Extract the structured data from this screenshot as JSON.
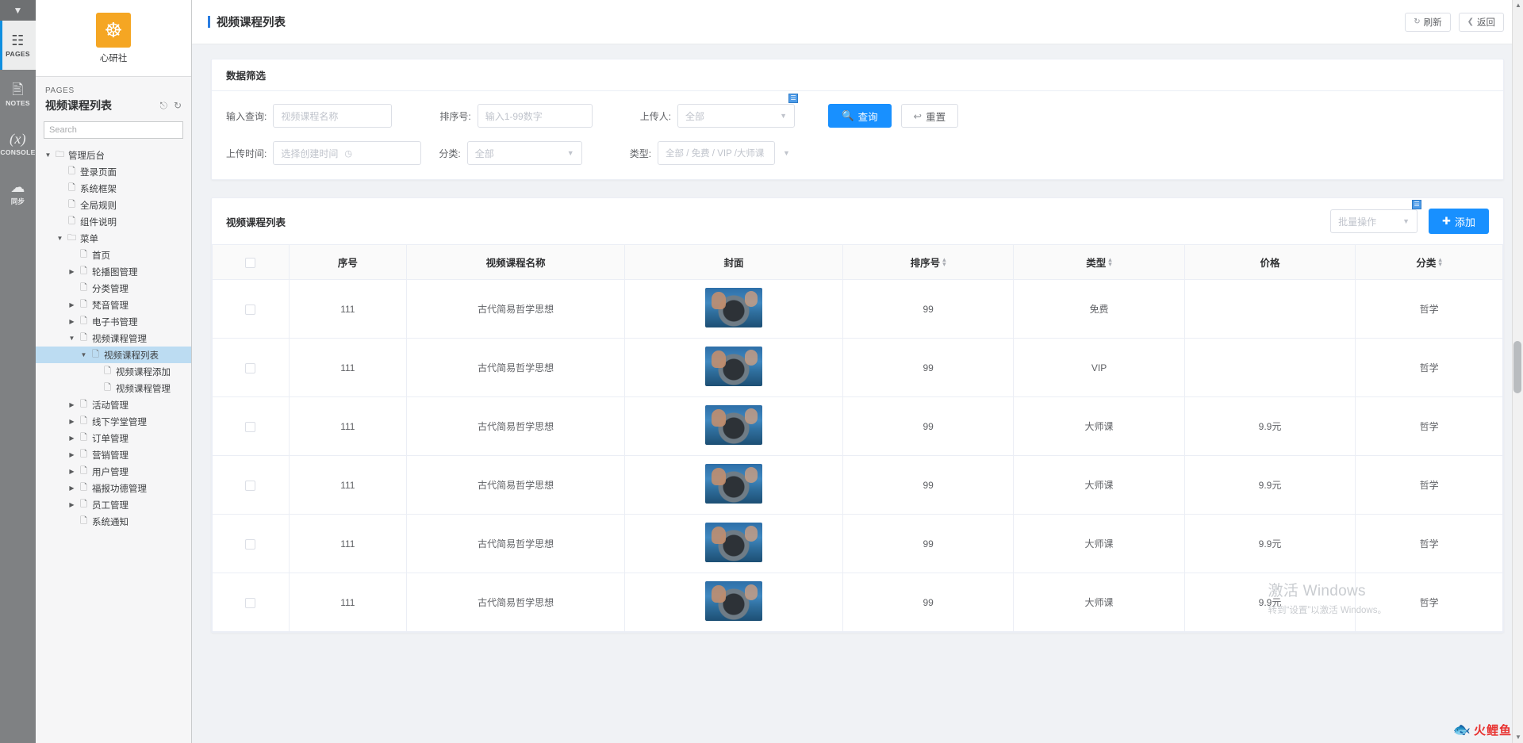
{
  "rail": {
    "collapse_icon": "chevron-down",
    "items": [
      {
        "label": "PAGES",
        "icon": "sitemap-icon",
        "active": true
      },
      {
        "label": "NOTES",
        "icon": "notes-icon",
        "active": false
      },
      {
        "label": "CONSOLE",
        "icon": "variable-icon",
        "active": false
      },
      {
        "label": "同步",
        "icon": "cloud-sync-icon",
        "active": false
      }
    ]
  },
  "brand": {
    "name": "心研社",
    "logo_glyph": "࿕",
    "logo_color": "#f5a623"
  },
  "pages_panel": {
    "kicker": "PAGES",
    "title": "视频课程列表",
    "icon_expand": "expand-icon",
    "icon_refresh": "refresh-icon",
    "search_placeholder": "Search",
    "search_value": ""
  },
  "tree": [
    {
      "label": "管理后台",
      "depth": 0,
      "type": "folder",
      "twisty": "down",
      "selected": false
    },
    {
      "label": "登录页面",
      "depth": 1,
      "type": "page",
      "twisty": "none",
      "selected": false
    },
    {
      "label": "系统框架",
      "depth": 1,
      "type": "page",
      "twisty": "none",
      "selected": false
    },
    {
      "label": "全局规则",
      "depth": 1,
      "type": "page",
      "twisty": "none",
      "selected": false
    },
    {
      "label": "组件说明",
      "depth": 1,
      "type": "page",
      "twisty": "none",
      "selected": false
    },
    {
      "label": "菜单",
      "depth": 1,
      "type": "folder",
      "twisty": "down",
      "selected": false
    },
    {
      "label": "首页",
      "depth": 2,
      "type": "page",
      "twisty": "none",
      "selected": false
    },
    {
      "label": "轮播图管理",
      "depth": 2,
      "type": "page",
      "twisty": "right",
      "selected": false
    },
    {
      "label": "分类管理",
      "depth": 2,
      "type": "page",
      "twisty": "none",
      "selected": false
    },
    {
      "label": "梵音管理",
      "depth": 2,
      "type": "page",
      "twisty": "right",
      "selected": false
    },
    {
      "label": "电子书管理",
      "depth": 2,
      "type": "page",
      "twisty": "right",
      "selected": false
    },
    {
      "label": "视频课程管理",
      "depth": 2,
      "type": "page",
      "twisty": "down",
      "selected": false
    },
    {
      "label": "视频课程列表",
      "depth": 3,
      "type": "page",
      "twisty": "down",
      "selected": true
    },
    {
      "label": "视频课程添加",
      "depth": 4,
      "type": "page",
      "twisty": "none",
      "selected": false
    },
    {
      "label": "视频课程管理",
      "depth": 4,
      "type": "page",
      "twisty": "none",
      "selected": false
    },
    {
      "label": "活动管理",
      "depth": 2,
      "type": "page",
      "twisty": "right",
      "selected": false
    },
    {
      "label": "线下学堂管理",
      "depth": 2,
      "type": "page",
      "twisty": "right",
      "selected": false
    },
    {
      "label": "订单管理",
      "depth": 2,
      "type": "page",
      "twisty": "right",
      "selected": false
    },
    {
      "label": "营销管理",
      "depth": 2,
      "type": "page",
      "twisty": "right",
      "selected": false
    },
    {
      "label": "用户管理",
      "depth": 2,
      "type": "page",
      "twisty": "right",
      "selected": false
    },
    {
      "label": "福报功德管理",
      "depth": 2,
      "type": "page",
      "twisty": "right",
      "selected": false
    },
    {
      "label": "员工管理",
      "depth": 2,
      "type": "page",
      "twisty": "right",
      "selected": false
    },
    {
      "label": "系统通知",
      "depth": 2,
      "type": "page",
      "twisty": "none",
      "selected": false
    }
  ],
  "page_header": {
    "title": "视频课程列表",
    "refresh_label": "刷新",
    "refresh_icon": "refresh-icon",
    "back_label": "返回",
    "back_icon": "chevron-left-icon"
  },
  "filter": {
    "title": "数据筛选",
    "fields": {
      "name_label": "输入查询:",
      "name_placeholder": "视频课程名称",
      "name_value": "",
      "sort_label": "排序号:",
      "sort_placeholder": "输入1-99数字",
      "sort_value": "",
      "uploader_label": "上传人:",
      "uploader_value": "全部",
      "time_label": "上传时间:",
      "time_placeholder": "选择创建时间",
      "time_value": "",
      "category_label": "分类:",
      "category_value": "全部",
      "type_label": "类型:",
      "type_value": "全部 / 免费 / VIP /大师课"
    },
    "search_button": "查询",
    "search_icon": "search-icon",
    "reset_button": "重置",
    "reset_icon": "undo-icon",
    "note_marker": "note-icon"
  },
  "table": {
    "title": "视频课程列表",
    "batch_placeholder": "批量操作",
    "add_label": "添加",
    "add_icon": "plus-icon",
    "note_marker": "note-icon",
    "columns": [
      {
        "label": "",
        "name": "select-all",
        "sortable": false
      },
      {
        "label": "序号",
        "name": "index",
        "sortable": false
      },
      {
        "label": "视频课程名称",
        "name": "course-name",
        "sortable": false
      },
      {
        "label": "封面",
        "name": "cover",
        "sortable": false
      },
      {
        "label": "排序号",
        "name": "sort-order",
        "sortable": true
      },
      {
        "label": "类型",
        "name": "type",
        "sortable": true
      },
      {
        "label": "价格",
        "name": "price",
        "sortable": false
      },
      {
        "label": "分类",
        "name": "category",
        "sortable": true
      }
    ],
    "rows": [
      {
        "index": "111",
        "name": "古代简易哲学思想",
        "cover": "camera-photo",
        "sort": "99",
        "type": "免费",
        "price": "",
        "category": "哲学"
      },
      {
        "index": "111",
        "name": "古代简易哲学思想",
        "cover": "camera-photo",
        "sort": "99",
        "type": "VIP",
        "price": "",
        "category": "哲学"
      },
      {
        "index": "111",
        "name": "古代简易哲学思想",
        "cover": "camera-photo",
        "sort": "99",
        "type": "大师课",
        "price": "9.9元",
        "category": "哲学"
      },
      {
        "index": "111",
        "name": "古代简易哲学思想",
        "cover": "camera-photo",
        "sort": "99",
        "type": "大师课",
        "price": "9.9元",
        "category": "哲学"
      },
      {
        "index": "111",
        "name": "古代简易哲学思想",
        "cover": "camera-photo",
        "sort": "99",
        "type": "大师课",
        "price": "9.9元",
        "category": "哲学"
      },
      {
        "index": "111",
        "name": "古代简易哲学思想",
        "cover": "camera-photo",
        "sort": "99",
        "type": "大师课",
        "price": "9.9元",
        "category": "哲学"
      }
    ]
  },
  "watermark": {
    "line1": "激活 Windows",
    "line2": "转到“设置”以激活 Windows。"
  },
  "corner_logo": {
    "text": "火鲤鱼",
    "icon": "fish-icon",
    "color": "#e8312f"
  },
  "colors": {
    "primary": "#1890ff",
    "accent_bar": "#2a7de1",
    "selected_row": "#bcdcf2",
    "brand": "#f5a623"
  }
}
